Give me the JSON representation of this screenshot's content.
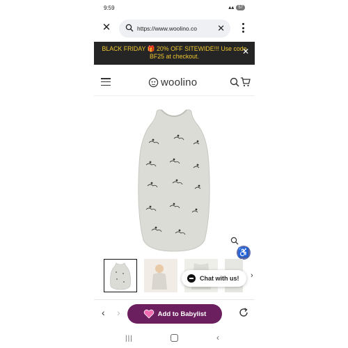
{
  "status_bar": {
    "time": "9:59",
    "battery": "57"
  },
  "browser": {
    "url": "https://www.woolino.co"
  },
  "banner": {
    "line1": "BLACK FRIDAY 🎁 20% OFF SITEWIDE!!! Use code",
    "line2": "BF25 at checkout."
  },
  "header": {
    "logo_text": "woolino"
  },
  "chat": {
    "label": "Chat with us!"
  },
  "toolbar": {
    "babylist_label": "Add to Babylist"
  },
  "colors": {
    "banner_bg": "#252525",
    "banner_text": "#f0c830",
    "babylist_bg": "#6b1f5e",
    "a11y_bg": "#5e6ba8"
  },
  "icons": [
    "close-icon",
    "search-icon",
    "more-vert-icon",
    "hamburger-icon",
    "cart-icon",
    "zoom-icon",
    "accessibility-icon",
    "chat-icon",
    "chevron-right-icon",
    "back-arrow-icon",
    "forward-arrow-icon",
    "heart-icon",
    "reload-icon"
  ]
}
